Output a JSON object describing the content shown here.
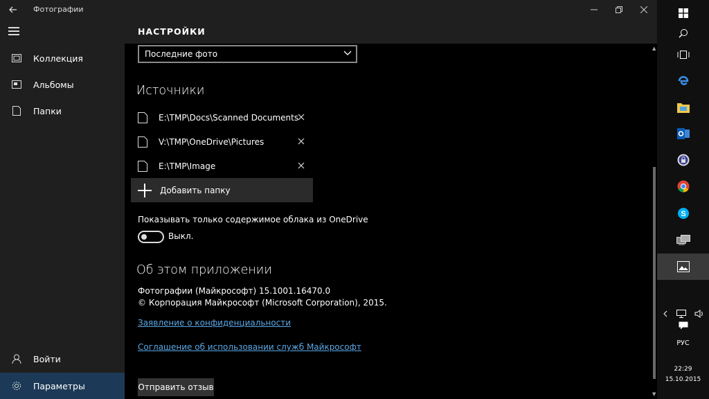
{
  "window": {
    "title": "Фотографии"
  },
  "nav": {
    "items": [
      {
        "label": "Коллекция",
        "icon": "collection-icon"
      },
      {
        "label": "Альбомы",
        "icon": "albums-icon"
      },
      {
        "label": "Папки",
        "icon": "folders-icon"
      }
    ],
    "bottom": [
      {
        "label": "Войти",
        "icon": "person-icon"
      },
      {
        "label": "Параметры",
        "icon": "gear-icon"
      }
    ]
  },
  "settings": {
    "header": "НАСТРОЙКИ",
    "dropdown_value": "Последние фото",
    "sources_title": "Источники",
    "sources": [
      {
        "path": "E:\\TMP\\Docs\\Scanned Documents"
      },
      {
        "path": "V:\\TMP\\OneDrive\\Pictures"
      },
      {
        "path": "E:\\TMP\\Image"
      }
    ],
    "add_folder": "Добавить папку",
    "onedrive_label": "Показывать только содержимое облака из OneDrive",
    "onedrive_toggle": "Выкл.",
    "about_title": "Об этом приложении",
    "about_version": "Фотографии (Майкрософт) 15.1001.16470.0",
    "about_copyright": "© Корпорация Майкрософт (Microsoft Corporation), 2015.",
    "privacy_link": "Заявление о конфиденциальности",
    "terms_link": "Соглашение об использовании служб Майкрософт",
    "feedback_button": "Отправить отзыв"
  },
  "taskbar": {
    "apps": [
      "start-icon",
      "search-icon",
      "task-view-icon",
      "edge-icon",
      "file-explorer-icon",
      "outlook-icon",
      "keepass-icon",
      "chrome-icon",
      "skype-icon",
      "remote-desktop-icon",
      "photos-icon"
    ],
    "language": "РУС",
    "time": "22:29",
    "date": "15.10.2015"
  },
  "colors": {
    "accent": "#1c3a57",
    "link": "#5aa8e6"
  }
}
